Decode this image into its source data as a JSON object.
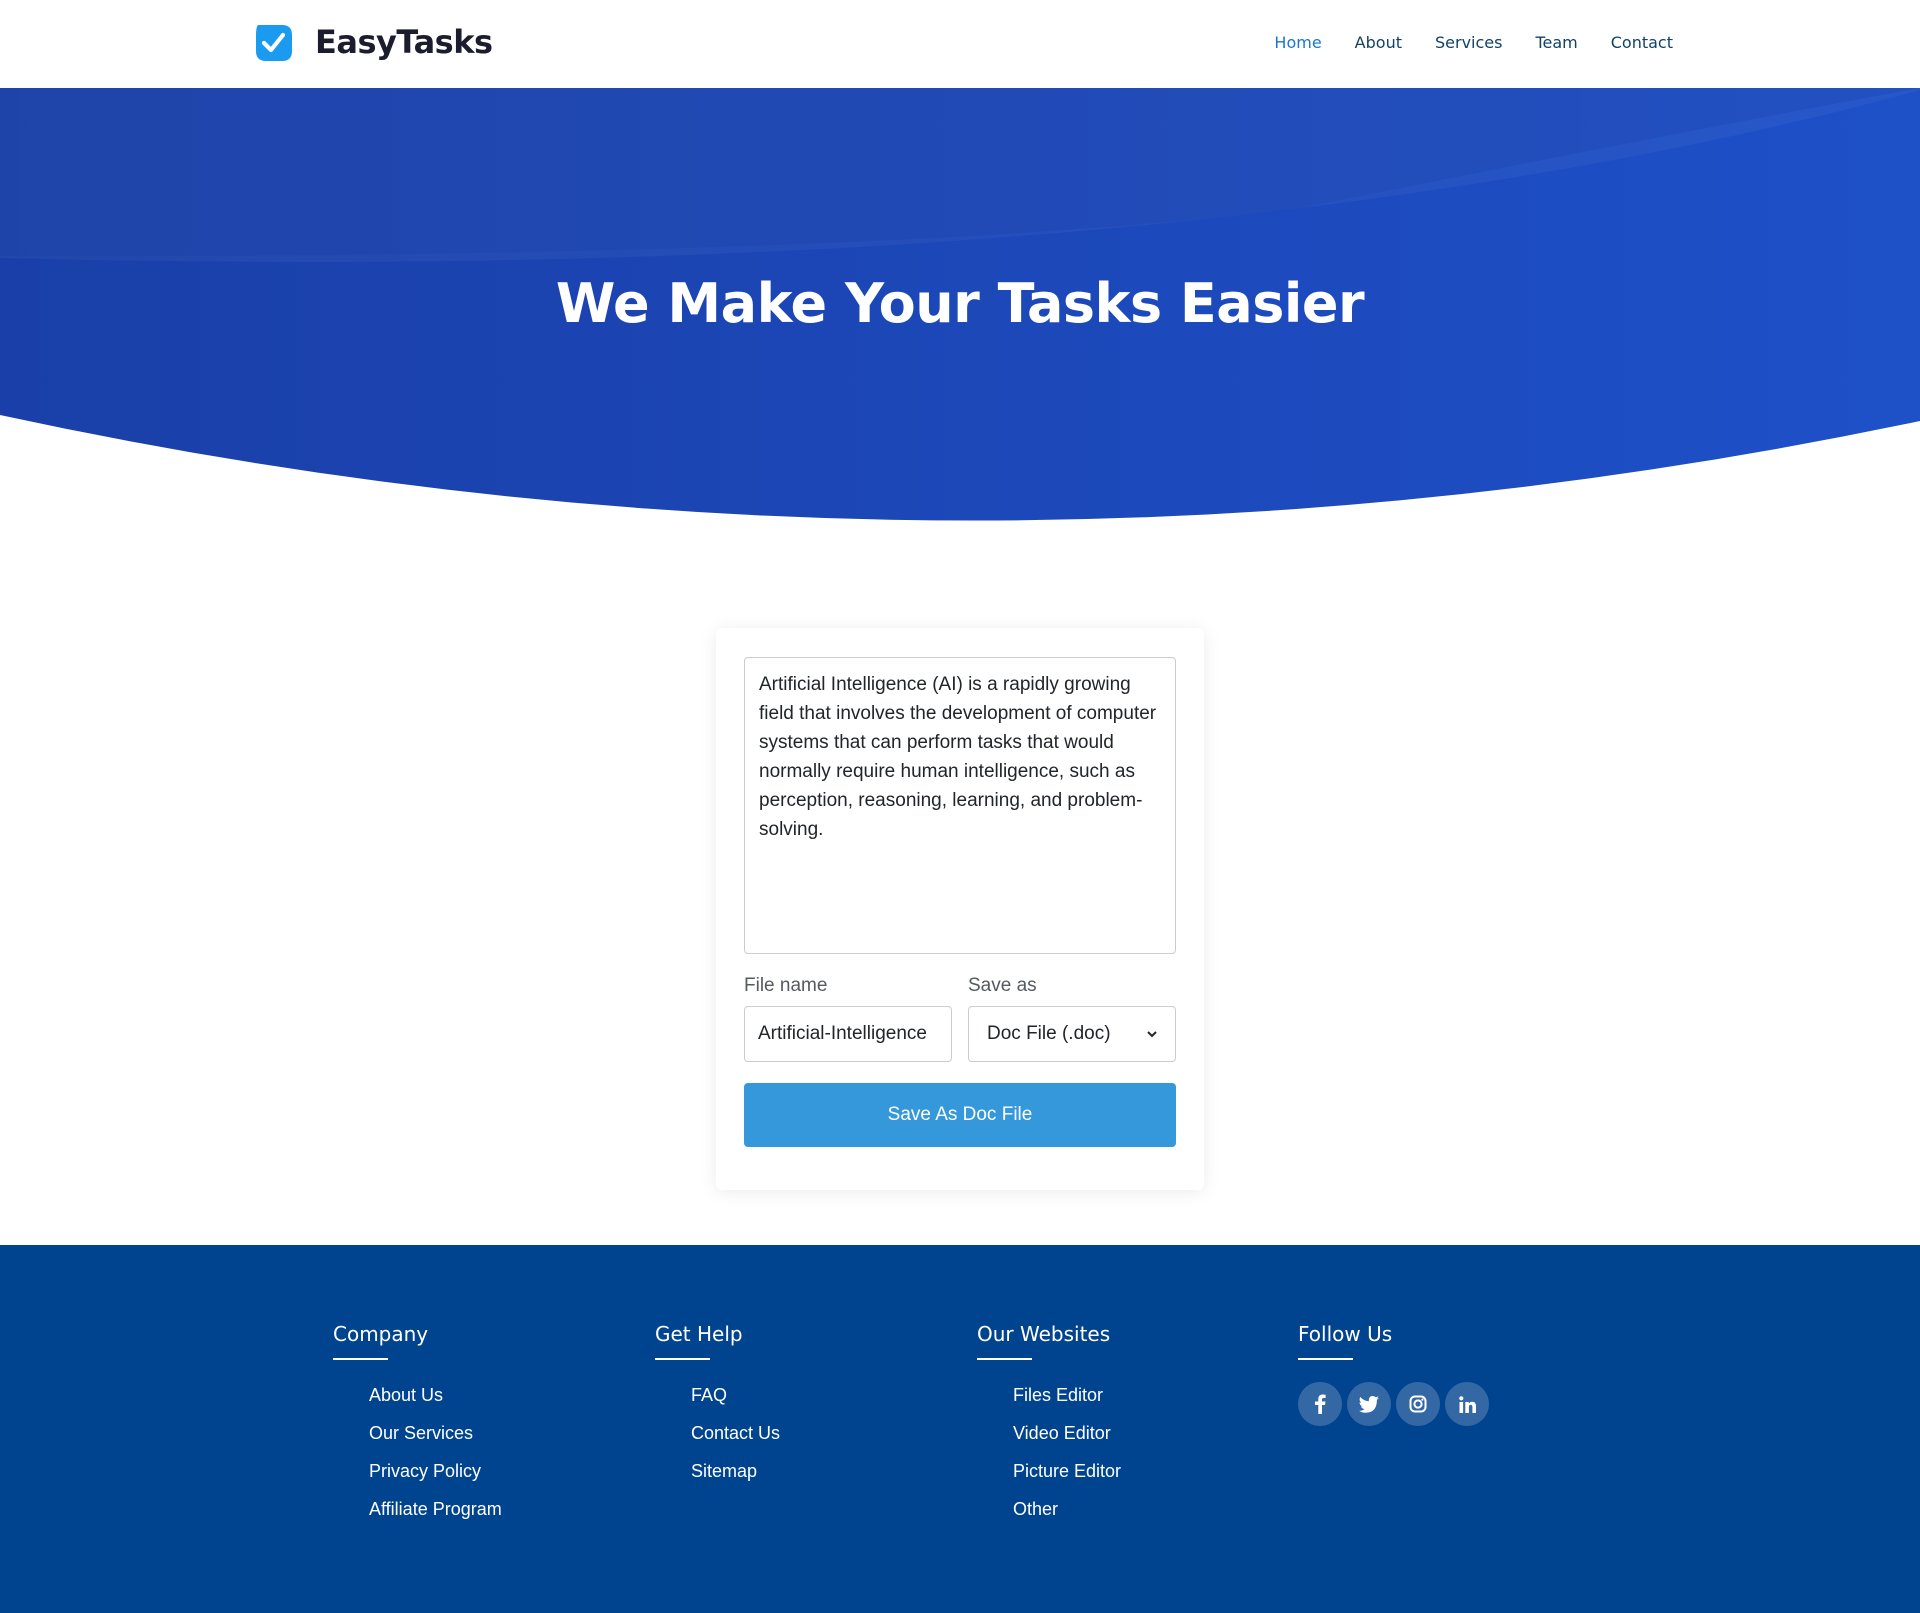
{
  "header": {
    "brand": "EasyTasks",
    "nav": [
      {
        "label": "Home",
        "active": true
      },
      {
        "label": "About",
        "active": false
      },
      {
        "label": "Services",
        "active": false
      },
      {
        "label": "Team",
        "active": false
      },
      {
        "label": "Contact",
        "active": false
      }
    ]
  },
  "hero": {
    "title": "We Make Your Tasks Easier"
  },
  "converter": {
    "text": "Artificial Intelligence (AI) is a rapidly growing field that involves the development of computer systems that can perform tasks that would normally require human intelligence, such as perception, reasoning, learning, and problem-solving.",
    "file_name_label": "File name",
    "file_name_value": "Artificial-Intelligence",
    "save_as_label": "Save as",
    "save_as_value": "Doc File (.doc)",
    "save_button": "Save As Doc File"
  },
  "footer": {
    "columns": [
      {
        "heading": "Company",
        "links": [
          "About Us",
          "Our Services",
          "Privacy Policy",
          "Affiliate Program"
        ]
      },
      {
        "heading": "Get Help",
        "links": [
          "FAQ",
          "Contact Us",
          "Sitemap"
        ]
      },
      {
        "heading": "Our Websites",
        "links": [
          "Files Editor",
          "Video Editor",
          "Picture Editor",
          "Other"
        ]
      },
      {
        "heading": "Follow Us",
        "links": []
      }
    ],
    "social": [
      "facebook-icon",
      "twitter-icon",
      "instagram-icon",
      "linkedin-icon"
    ]
  },
  "colors": {
    "accent": "#1977cc",
    "hero_blue": "#1a47b8",
    "button": "#3498db",
    "footer": "#00438e",
    "logo": "#1a9bf0"
  }
}
